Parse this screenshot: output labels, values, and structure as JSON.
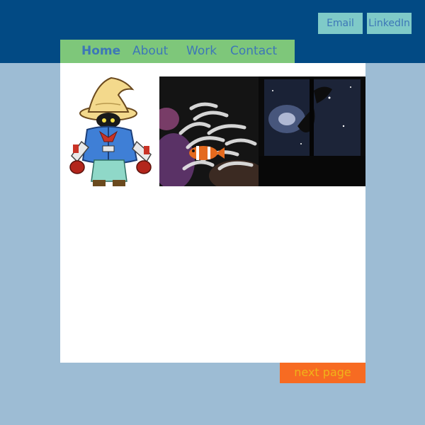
{
  "header": {
    "social": {
      "email_label": "Email",
      "linkedin_label": "LinkedIn"
    }
  },
  "nav": {
    "items": [
      {
        "label": "Home",
        "active": true
      },
      {
        "label": "About",
        "active": false
      },
      {
        "label": "Work",
        "active": false
      },
      {
        "label": "Contact",
        "active": false
      }
    ]
  },
  "gallery": {
    "images": [
      {
        "name": "black-mage-character-image"
      },
      {
        "name": "clownfish-anemone-image"
      },
      {
        "name": "space-galaxy-window-image"
      }
    ]
  },
  "footer": {
    "next_label": "next page"
  },
  "colors": {
    "background": "#9dbcd4",
    "header": "#024a84",
    "nav": "#7ec77a",
    "social_button": "#7fcac8",
    "link_text": "#3d77b7",
    "next_button": "#f76b22",
    "next_text": "#f0b31a"
  }
}
